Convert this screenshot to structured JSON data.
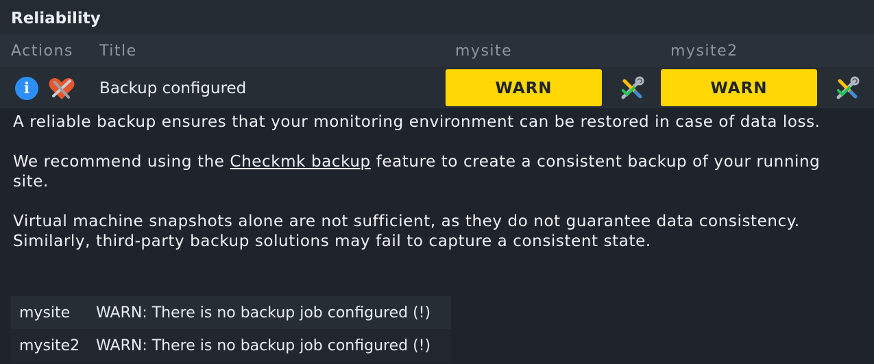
{
  "section": {
    "title": "Reliability"
  },
  "table": {
    "headers": {
      "actions": "Actions",
      "title": "Title",
      "site1": "mysite",
      "site2": "mysite2"
    }
  },
  "row": {
    "title": "Backup configured",
    "info_icon": "info-icon",
    "action_icon": "rule-heart-icon",
    "site1_state": "WARN",
    "site2_state": "WARN",
    "site_action_icon": "wrench-screwdriver-icon"
  },
  "description": {
    "p1": "A reliable backup ensures that your monitoring environment can be restored in case of data loss.",
    "p2_before": "We recommend using the ",
    "p2_link": "Checkmk backup",
    "p2_after": " feature to create a consistent backup of your running site.",
    "p3_line1": "Virtual machine snapshots alone are not sufficient, as they do not guarantee data consistency.",
    "p3_line2": "Similarly, third-party backup solutions may fail to capture a consistent state."
  },
  "results": [
    {
      "site": "mysite",
      "message": "WARN: There is no backup job configured (!)"
    },
    {
      "site": "mysite2",
      "message": "WARN: There is no backup job configured (!)"
    }
  ],
  "colors": {
    "warn": "#ffd703",
    "info": "#2c8ff5",
    "background": "#1f242c"
  }
}
